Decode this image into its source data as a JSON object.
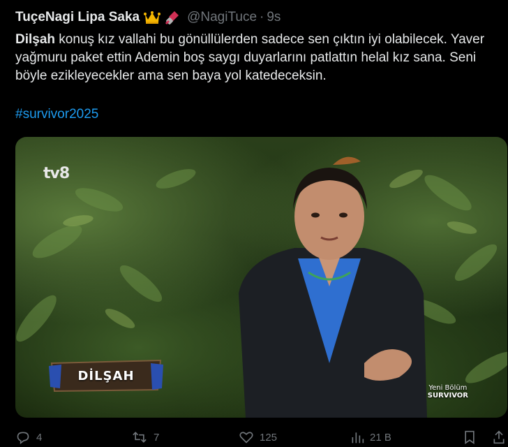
{
  "tweet": {
    "author_name": "TuçeNagi Lipa Saka",
    "handle": "@NagiTuce",
    "separator": "·",
    "time_ago": "9s",
    "text_bold": "Dilşah",
    "text_rest": " konuş kız vallahi bu gönüllülerden sadece sen çıktın iyi olabilecek. Yaver yağmuru paket ettin Ademin boş saygı duyarlarını patlattın helal kız sana. Seni böyle ezikleyecekler ama sen baya yol katedeceksin.",
    "hashtag": "#survivor2025",
    "author_emojis": [
      "crown-icon",
      "nail-polish-icon"
    ]
  },
  "media": {
    "channel_logo": "tv8",
    "nameplate": "DİLŞAH",
    "show_tag_line1": "Yeni Bölüm",
    "show_tag_line2": "SURVIVOR"
  },
  "actions": {
    "reply_count": "4",
    "retweet_count": "7",
    "like_count": "125",
    "views_count": "21 B"
  },
  "colors": {
    "background": "#000000",
    "text": "#e7e9ea",
    "muted": "#71767b",
    "link": "#1d9bf0"
  }
}
